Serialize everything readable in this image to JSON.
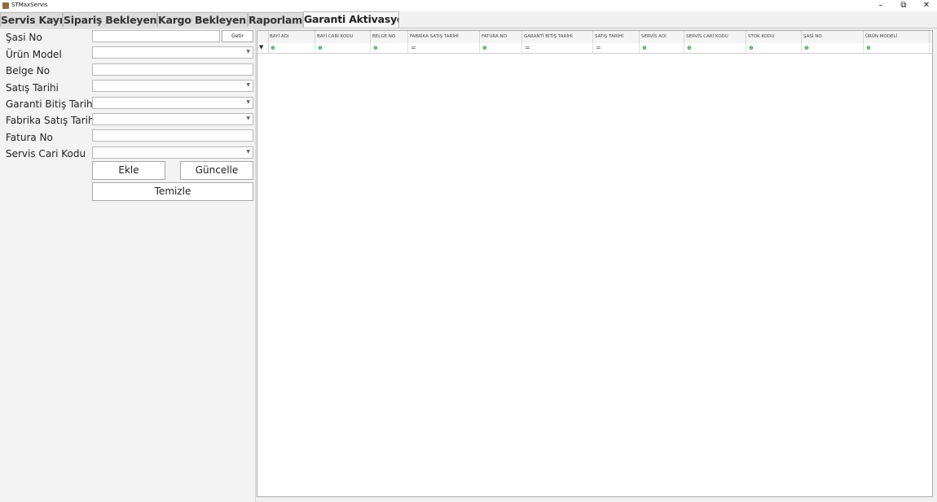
{
  "window": {
    "title": "STMaxServis",
    "minimize": "–",
    "maximize": "⧉",
    "close": "✕"
  },
  "tabs": [
    {
      "label": "Servis Kayıt"
    },
    {
      "label": "Sipariş Bekleyenler"
    },
    {
      "label": "Kargo Bekleyenler"
    },
    {
      "label": "Raporlama"
    },
    {
      "label": "Garanti Aktivasyon"
    }
  ],
  "form": {
    "sasi_no_label": "Şasi No",
    "sasi_no_value": "",
    "getir_label": "Getir",
    "urun_model_label": "Ürün Model",
    "urun_model_value": "",
    "belge_no_label": "Belge No",
    "belge_no_value": "",
    "satis_tarihi_label": "Satış Tarihi",
    "satis_tarihi_value": "",
    "garanti_bitis_label": "Garanti Bitiş Tarihi",
    "garanti_bitis_value": "",
    "fabrika_satis_label": "Fabrika Satış Tarihi",
    "fabrika_satis_value": "",
    "fatura_no_label": "Fatura No",
    "fatura_no_value": "",
    "servis_cari_label": "Servis Cari Kodu",
    "servis_cari_value": "",
    "ekle_label": "Ekle",
    "guncelle_label": "Güncelle",
    "temizle_label": "Temizle"
  },
  "grid": {
    "columns": [
      {
        "header": "BAYİ ADI",
        "filter": "ab"
      },
      {
        "header": "BAYİ CARİ KODU",
        "filter": "ab"
      },
      {
        "header": "BELGE NO",
        "filter": "ab"
      },
      {
        "header": "FABRİKA SATIŞ TARİHİ",
        "filter": "eq"
      },
      {
        "header": "FATURA NO",
        "filter": "ab"
      },
      {
        "header": "GARANTİ BİTİŞ TARİHİ",
        "filter": "eq"
      },
      {
        "header": "SATIŞ TARİHİ",
        "filter": "eq"
      },
      {
        "header": "SERVİS ADI",
        "filter": "ab"
      },
      {
        "header": "SERVİS CARİ KODU",
        "filter": "ab"
      },
      {
        "header": "STOK KODU",
        "filter": "ab"
      },
      {
        "header": "ŞASİ NO",
        "filter": "ab"
      },
      {
        "header": "ÜRÜN MODELİ",
        "filter": "ab"
      }
    ],
    "filter_icon_ab": "⊕",
    "filter_icon_eq": "=",
    "funnel_icon": "▼"
  }
}
